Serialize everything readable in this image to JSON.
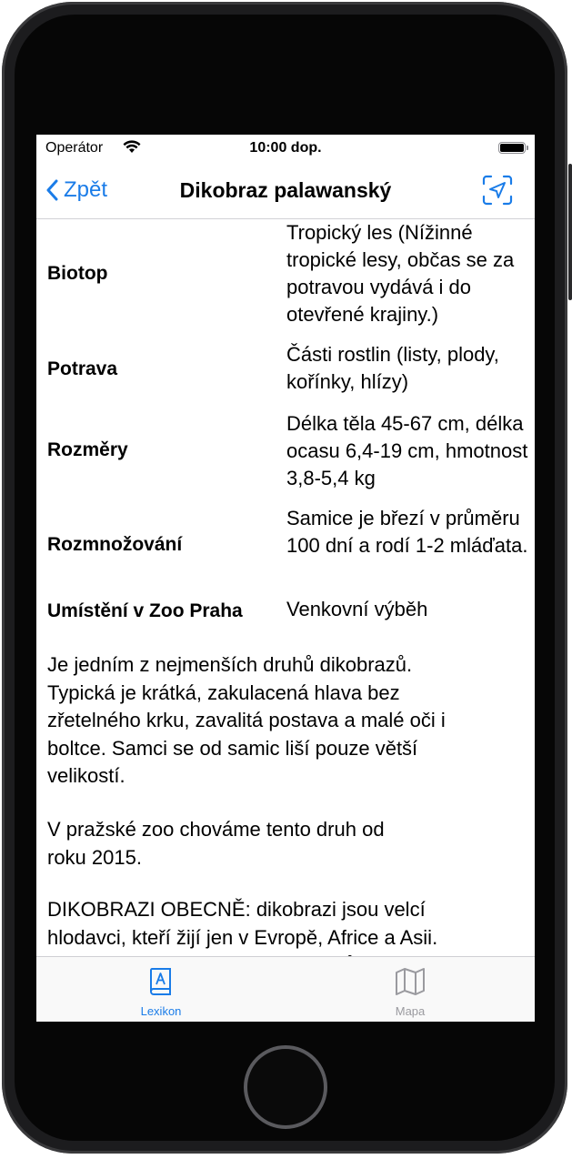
{
  "status": {
    "carrier": "Operátor",
    "time": "10:00 dop."
  },
  "nav": {
    "back_label": "Zpět",
    "title": "Dikobraz palawanský",
    "accent": "#1a7ce8"
  },
  "info": [
    {
      "label": "Biotop",
      "value": "Tropický les (Nížinné tropické lesy, občas se za potravou vydává i do otevřené krajiny.)"
    },
    {
      "label": "Potrava",
      "value": "Části rostlin (listy, plody, kořínky, hlízy)"
    },
    {
      "label": "Rozměry",
      "value": "Délka těla 45-67 cm, délka ocasu 6,4-19 cm, hmotnost 3,8-5,4 kg"
    },
    {
      "label": "Rozmnožování",
      "value": "Samice je březí v průměru 100 dní a rodí 1-2 mláďata."
    },
    {
      "label": "Umístění v Zoo Praha",
      "value": "Venkovní výběh"
    }
  ],
  "description": {
    "p1": "Je jedním z nejmenších druhů dikobrazů.\nTypická je krátká, zakulacená hlava bez\nzřetelného krku, zavalitá postava a malé oči i\nboltce. Samci se od samic liší pouze větší\nvelikostí.",
    "p2": "V pražské zoo chováme tento druh od\nroku 2015.",
    "p3": "DIKOBRAZI OBECNĚ: dikobrazi jsou velcí\nhlodavci, kteří žijí jen v Evropě, Africe a Asii.\nA jich poznat podle dlouhých ostnů a bodlin."
  },
  "tabs": [
    {
      "label": "Lexikon",
      "icon": "book-icon",
      "active": true
    },
    {
      "label": "Mapa",
      "icon": "map-icon",
      "active": false
    }
  ]
}
